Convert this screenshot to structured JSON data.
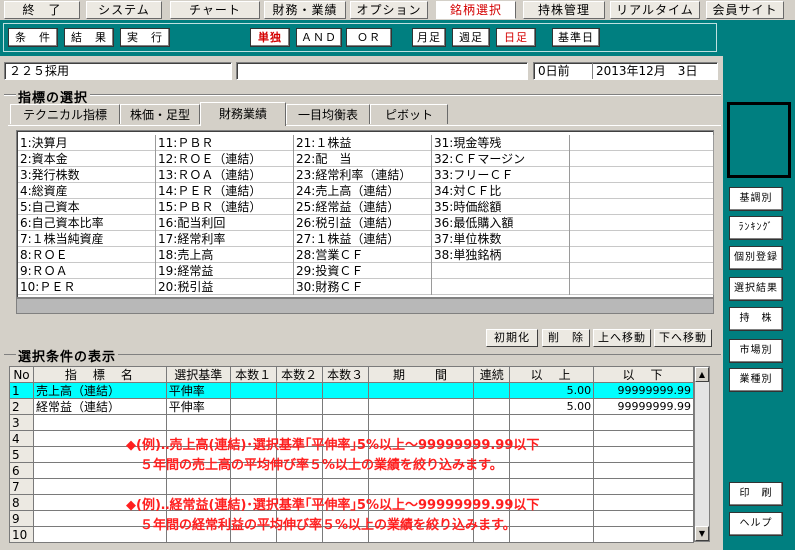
{
  "menu_tabs": [
    {
      "label": "終　了"
    },
    {
      "label": "システム"
    },
    {
      "label": "チャート"
    },
    {
      "label": "財務・業績"
    },
    {
      "label": "オプション"
    },
    {
      "label": "銘柄選択"
    },
    {
      "label": "持株管理"
    },
    {
      "label": "リアルタイム"
    },
    {
      "label": "会員サイト"
    }
  ],
  "toolbar": {
    "condition": "条　件",
    "result": "結　果",
    "execute": "実　行",
    "single": "単独",
    "and": "ＡＮＤ",
    "or": "ＯＲ",
    "monthly": "月足",
    "weekly": "週足",
    "daily": "日足",
    "base_date": "基準日"
  },
  "info_bar": {
    "selection": "２２５採用",
    "middle": "",
    "days_before": "0日前",
    "date": "2013年12月　3日"
  },
  "indicator_section": {
    "title": "指標の選択",
    "tabs": [
      "テクニカル指標",
      "株価・足型",
      "財務業績",
      "一目均衡表",
      "ピボット"
    ],
    "active_tab": "財務業績",
    "columns": [
      [
        "1:決算月",
        "2:資本金",
        "3:発行株数",
        "4:総資産",
        "5:自己資本",
        "6:自己資本比率",
        "7:１株当純資産",
        "8:ＲＯＥ",
        "9:ＲＯＡ",
        "10:ＰＥＲ"
      ],
      [
        "11:ＰＢＲ",
        "12:ＲＯＥ（連結）",
        "13:ＲＯＡ（連結）",
        "14:ＰＥＲ（連結）",
        "15:ＰＢＲ（連結）",
        "16:配当利回",
        "17:経常利率",
        "18:売上高",
        "19:経常益",
        "20:税引益"
      ],
      [
        "21:１株益",
        "22:配　当",
        "23:経常利率（連結）",
        "24:売上高（連結）",
        "25:経常益（連結）",
        "26:税引益（連結）",
        "27:１株益（連結）",
        "28:営業ＣＦ",
        "29:投資ＣＦ",
        "30:財務ＣＦ"
      ],
      [
        "31:現金等残",
        "32:ＣＦマージン",
        "33:フリーＣＦ",
        "34:対ＣＦ比",
        "35:時価総額",
        "36:最低購入額",
        "37:単位株数",
        "38:単独銘柄",
        "",
        ""
      ],
      [
        "",
        "",
        "",
        "",
        "",
        "",
        "",
        "",
        "",
        ""
      ]
    ]
  },
  "grid_buttons": {
    "init": "初期化",
    "delete": "削　除",
    "move_up": "上へ移動",
    "move_down": "下へ移動"
  },
  "conditions_section": {
    "title": "選択条件の表示",
    "headers": [
      "No",
      "指　標　名",
      "選択基準",
      "本数１",
      "本数２",
      "本数３",
      "期　　間",
      "連続",
      "以　上",
      "以　下"
    ],
    "rows": [
      {
        "no": "1",
        "name": "売上高（連結）",
        "basis": "平伸率",
        "n1": "",
        "n2": "",
        "n3": "",
        "period": "",
        "cont": "",
        "min": "5.00",
        "max": "99999999.99"
      },
      {
        "no": "2",
        "name": "経常益（連結）",
        "basis": "平伸率",
        "n1": "",
        "n2": "",
        "n3": "",
        "period": "",
        "cont": "",
        "min": "5.00",
        "max": "99999999.99"
      },
      {
        "no": "3",
        "name": "",
        "basis": "",
        "n1": "",
        "n2": "",
        "n3": "",
        "period": "",
        "cont": "",
        "min": "",
        "max": ""
      },
      {
        "no": "4",
        "name": "",
        "basis": "",
        "n1": "",
        "n2": "",
        "n3": "",
        "period": "",
        "cont": "",
        "min": "",
        "max": ""
      },
      {
        "no": "5",
        "name": "",
        "basis": "",
        "n1": "",
        "n2": "",
        "n3": "",
        "period": "",
        "cont": "",
        "min": "",
        "max": ""
      },
      {
        "no": "6",
        "name": "",
        "basis": "",
        "n1": "",
        "n2": "",
        "n3": "",
        "period": "",
        "cont": "",
        "min": "",
        "max": ""
      },
      {
        "no": "7",
        "name": "",
        "basis": "",
        "n1": "",
        "n2": "",
        "n3": "",
        "period": "",
        "cont": "",
        "min": "",
        "max": ""
      },
      {
        "no": "8",
        "name": "",
        "basis": "",
        "n1": "",
        "n2": "",
        "n3": "",
        "period": "",
        "cont": "",
        "min": "",
        "max": ""
      },
      {
        "no": "9",
        "name": "",
        "basis": "",
        "n1": "",
        "n2": "",
        "n3": "",
        "period": "",
        "cont": "",
        "min": "",
        "max": ""
      },
      {
        "no": "10",
        "name": "",
        "basis": "",
        "n1": "",
        "n2": "",
        "n3": "",
        "period": "",
        "cont": "",
        "min": "",
        "max": ""
      }
    ]
  },
  "annotations": {
    "line1": "◆(例)‥売上高(連結)･選択基準｢平伸率｣5%以上～99999999.99以下",
    "line2": "５年間の売上高の平均伸び率５%以上の業績を絞り込みます。",
    "line3": "◆(例)‥経常益(連結)･選択基準｢平伸率｣5%以上～99999999.99以下",
    "line4": "５年間の経常利益の平均伸び率５%以上の業績を絞り込みます。"
  },
  "sidebar": {
    "buttons": [
      "基調別",
      "ﾗﾝｷﾝｸﾞ",
      "個別登録",
      "選択結果",
      "持　株",
      "市場別",
      "業種別",
      "印　刷",
      "ヘルプ"
    ]
  },
  "colors": {
    "teal": "#007f80",
    "selected_row": "#00ffff",
    "annotation_red": "#ff2020",
    "accent_red": "#d40000"
  },
  "icons": {
    "scroll_up": "triangle-up",
    "scroll_down": "triangle-down"
  }
}
